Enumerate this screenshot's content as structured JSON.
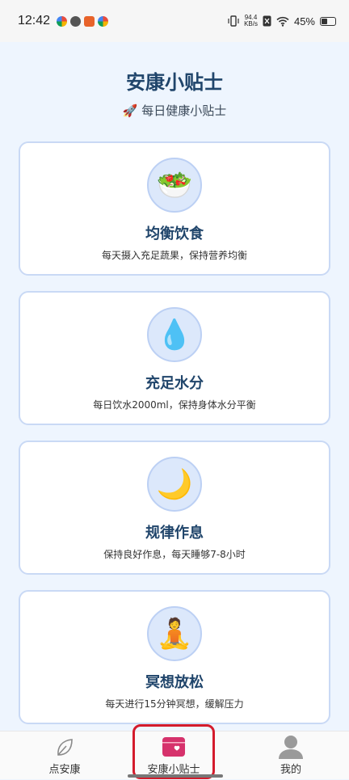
{
  "status_bar": {
    "time": "12:42",
    "net_speed": "94.4",
    "net_unit": "KB/s",
    "battery": "45%"
  },
  "header": {
    "title": "安康小贴士",
    "subtitle": "每日健康小贴士",
    "subtitle_icon": "rocket-emoji"
  },
  "tips": [
    {
      "icon": "🥗",
      "icon_name": "salad-icon",
      "title": "均衡饮食",
      "desc": "每天摄入充足蔬果，保持营养均衡"
    },
    {
      "icon": "💧",
      "icon_name": "droplet-icon",
      "title": "充足水分",
      "desc": "每日饮水2000ml，保持身体水分平衡"
    },
    {
      "icon": "🌙",
      "icon_name": "moon-icon",
      "title": "规律作息",
      "desc": "保持良好作息，每天睡够7-8小时"
    },
    {
      "icon": "🧘",
      "icon_name": "meditation-icon",
      "title": "冥想放松",
      "desc": "每天进行15分钟冥想，缓解压力"
    }
  ],
  "bottom_nav": {
    "items": [
      {
        "label": "点安康"
      },
      {
        "label": "安康小贴士"
      },
      {
        "label": "我的"
      }
    ],
    "active_color": "#d6326c"
  }
}
